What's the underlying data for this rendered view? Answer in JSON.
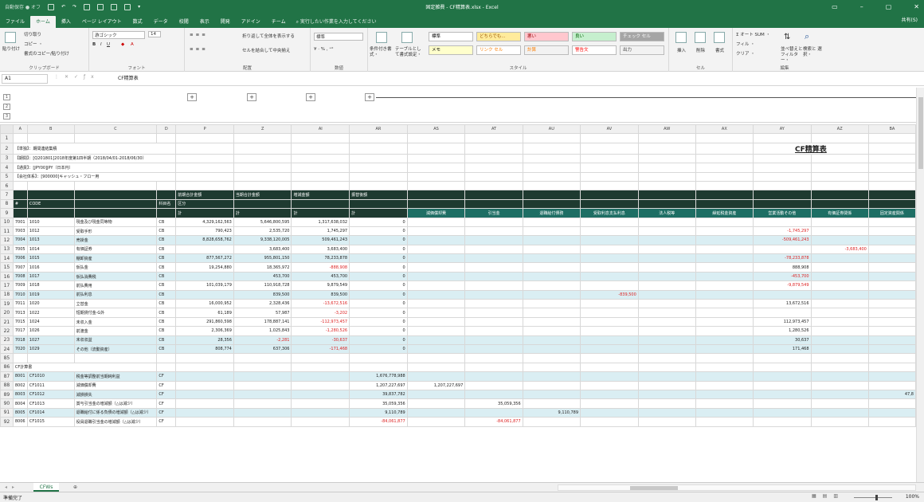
{
  "window": {
    "autosave": "自動保存 ● オフ",
    "title": "固定雑費 - CF精算表.xlsx - Excel",
    "controls": [
      "▭",
      "–",
      "▢",
      "✕"
    ]
  },
  "ribbon_tabs": [
    "ファイル",
    "ホーム",
    "挿入",
    "ページ レイアウト",
    "数式",
    "データ",
    "校閲",
    "表示",
    "開発",
    "アドイン",
    "チーム"
  ],
  "active_tab": "ホーム",
  "tell_me": "実行したい作業を入力してください",
  "share": "共有(S)",
  "ribbon": {
    "clipboard": {
      "paste": "貼り付け",
      "cut": "切り取り",
      "copy": "コピー ・",
      "format_painter": "書式のコピー/貼り付け",
      "label": "クリップボード"
    },
    "font": {
      "name": "游ゴシック",
      "size": "14",
      "label": "フォント"
    },
    "alignment": {
      "wrap": "折り返して全体を表示する",
      "merge": "セルを結合して中央揃え",
      "label": "配置"
    },
    "number": {
      "format": "標準",
      "label": "数値"
    },
    "styles": {
      "cond_format": "条件付き書式・",
      "table_format": "テーブルとして書式設定・",
      "cells": [
        {
          "text": "標準",
          "bg": "#ffffff",
          "color": "#000000"
        },
        {
          "text": "どちらでも...",
          "bg": "#ffeb9c",
          "color": "#9c5700"
        },
        {
          "text": "悪い",
          "bg": "#ffc7ce",
          "color": "#9c0006"
        },
        {
          "text": "良い",
          "bg": "#c6efce",
          "color": "#006100"
        },
        {
          "text": "チェック セル",
          "bg": "#a5a5a5",
          "color": "#ffffff"
        },
        {
          "text": "メモ",
          "bg": "#ffffcc",
          "color": "#000000"
        },
        {
          "text": "リンク セル",
          "bg": "#ffffff",
          "color": "#fa7d00"
        },
        {
          "text": "計算",
          "bg": "#f2f2f2",
          "color": "#fa7d00"
        },
        {
          "text": "警告文",
          "bg": "#ffffff",
          "color": "#ff0000"
        },
        {
          "text": "出力",
          "bg": "#f2f2f2",
          "color": "#3f3f3f"
        }
      ],
      "label": "スタイル"
    },
    "cells": {
      "insert": "挿入",
      "delete": "削除",
      "format": "書式",
      "label": "セル"
    },
    "editing": {
      "autosum": "Σ オート SUM ・",
      "fill": "フィル ・",
      "clear": "クリア ・",
      "sort": "並べ替えと フィルター・",
      "find": "検索と 選択・",
      "label": "編集"
    }
  },
  "name_box": "A1",
  "formula_text": "CF精算表",
  "outline_levels": [
    "1",
    "2",
    "3"
  ],
  "col_headers": [
    "A",
    "B",
    "C",
    "D",
    "P",
    "Z",
    "AI",
    "AR",
    "AS",
    "AT",
    "AU",
    "AV",
    "AW",
    "AX",
    "AY",
    "AZ",
    "BA"
  ],
  "sheet_title": "CF精算表",
  "meta_rows": [
    "【単独】：期間連結集積",
    "【期間】：[Q201801]2018年度第1四半期（2018/04/01-2018/06/30）",
    "【通貨】：[JPY00]JPY（日本円）",
    "【会社体系】：[900000]キャッシュ・フロー用"
  ],
  "table_headers": {
    "num": "#",
    "code": "CODE",
    "name": "科目名",
    "kbn": "区分",
    "prev": "前期合計金額",
    "curr": "当期合計金額",
    "diff": "増減金額",
    "alloc": "振替後額",
    "kei": "計"
  },
  "cf_headers": [
    "減価償却費",
    "引当金",
    "退職給付債務",
    "受取利息支払利息",
    "法人税等",
    "繰延税金資産",
    "営業活動その他",
    "有価証券関係",
    "固定資産関係"
  ],
  "rows": [
    {
      "r": "10",
      "a": "7001",
      "b": "1010",
      "c": "現金及び現金同等物",
      "d": "CB",
      "p": "4,329,162,563",
      "z": "5,646,800,595",
      "ai": "1,317,638,032",
      "ar": "0",
      "cells": [
        "",
        "",
        "",
        "",
        "",
        "",
        "",
        "",
        ""
      ],
      "tl": false
    },
    {
      "r": "11",
      "a": "7003",
      "b": "1012",
      "c": "受取手形",
      "d": "CB",
      "p": "790,423",
      "z": "2,535,720",
      "ai": "1,745,297",
      "ar": "0",
      "cells": [
        "",
        "",
        "",
        "",
        "",
        "",
        "-1,745,297",
        "",
        ""
      ],
      "tl": false
    },
    {
      "r": "12",
      "a": "7004",
      "b": "1013",
      "c": "売掛金",
      "d": "CB",
      "p": "8,828,658,762",
      "z": "9,338,120,005",
      "ai": "509,461,243",
      "ar": "0",
      "cells": [
        "",
        "",
        "",
        "",
        "",
        "",
        "-509,461,243",
        "",
        ""
      ],
      "tl": true
    },
    {
      "r": "13",
      "a": "7005",
      "b": "1014",
      "c": "有価証券",
      "d": "CB",
      "p": "",
      "z": "3,683,400",
      "ai": "3,683,400",
      "ar": "0",
      "cells": [
        "",
        "",
        "",
        "",
        "",
        "",
        "",
        "-3,683,400",
        ""
      ],
      "tl": false
    },
    {
      "r": "14",
      "a": "7006",
      "b": "1015",
      "c": "棚卸資産",
      "d": "CB",
      "p": "877,567,272",
      "z": "955,801,150",
      "ai": "78,233,878",
      "ar": "0",
      "cells": [
        "",
        "",
        "",
        "",
        "",
        "",
        "-78,233,878",
        "",
        ""
      ],
      "tl": true
    },
    {
      "r": "15",
      "a": "7007",
      "b": "1016",
      "c": "仮払金",
      "d": "CB",
      "p": "19,254,880",
      "z": "18,365,972",
      "ai": "-888,908",
      "ar": "0",
      "cells": [
        "",
        "",
        "",
        "",
        "",
        "",
        "888,908",
        "",
        ""
      ],
      "tl": false
    },
    {
      "r": "16",
      "a": "7008",
      "b": "1017",
      "c": "仮払消費税",
      "d": "CB",
      "p": "",
      "z": "453,700",
      "ai": "453,700",
      "ar": "0",
      "cells": [
        "",
        "",
        "",
        "",
        "",
        "",
        "-453,700",
        "",
        ""
      ],
      "tl": true
    },
    {
      "r": "17",
      "a": "7009",
      "b": "1018",
      "c": "前払費用",
      "d": "CB",
      "p": "101,039,179",
      "z": "110,918,728",
      "ai": "9,879,549",
      "ar": "0",
      "cells": [
        "",
        "",
        "",
        "",
        "",
        "",
        "-9,879,549",
        "",
        ""
      ],
      "tl": false
    },
    {
      "r": "18",
      "a": "7010",
      "b": "1019",
      "c": "前払利息",
      "d": "CB",
      "p": "",
      "z": "839,500",
      "ai": "839,500",
      "ar": "0",
      "cells": [
        "",
        "",
        "",
        "-839,500",
        "",
        "",
        "",
        "",
        ""
      ],
      "tl": true
    },
    {
      "r": "19",
      "a": "7011",
      "b": "1020",
      "c": "立替金",
      "d": "CB",
      "p": "16,000,952",
      "z": "2,328,436",
      "ai": "-13,672,516",
      "ar": "0",
      "cells": [
        "",
        "",
        "",
        "",
        "",
        "",
        "13,672,516",
        "",
        ""
      ],
      "tl": false
    },
    {
      "r": "20",
      "a": "7013",
      "b": "1022",
      "c": "短期貸付金-G外",
      "d": "CB",
      "p": "61,189",
      "z": "57,987",
      "ai": "-3,202",
      "ar": "0",
      "cells": [
        "",
        "",
        "",
        "",
        "",
        "",
        "",
        "",
        ""
      ],
      "tl": false
    },
    {
      "r": "21",
      "a": "7015",
      "b": "1024",
      "c": "未収入金",
      "d": "CB",
      "p": "291,860,598",
      "z": "178,887,141",
      "ai": "-112,973,457",
      "ar": "0",
      "cells": [
        "",
        "",
        "",
        "",
        "",
        "",
        "112,973,457",
        "",
        ""
      ],
      "tl": false
    },
    {
      "r": "22",
      "a": "7017",
      "b": "1026",
      "c": "前渡金",
      "d": "CB",
      "p": "2,306,369",
      "z": "1,025,843",
      "ai": "-1,280,526",
      "ar": "0",
      "cells": [
        "",
        "",
        "",
        "",
        "",
        "",
        "1,280,526",
        "",
        ""
      ],
      "tl": false
    },
    {
      "r": "23",
      "a": "7018",
      "b": "1027",
      "c": "未収収益",
      "d": "CB",
      "p": "28,356",
      "z": "-2,281",
      "ai": "-30,637",
      "ar": "0",
      "cells": [
        "",
        "",
        "",
        "",
        "",
        "",
        "30,637",
        "",
        ""
      ],
      "tl": true
    },
    {
      "r": "24",
      "a": "7020",
      "b": "1029",
      "c": "その他（流動資産）",
      "d": "CB",
      "p": "808,774",
      "z": "637,306",
      "ai": "-171,468",
      "ar": "0",
      "cells": [
        "",
        "",
        "",
        "",
        "",
        "",
        "171,468",
        "",
        ""
      ],
      "tl": true
    }
  ],
  "cf_section": {
    "r": "86",
    "label": "CF計算書"
  },
  "cf_rows": [
    {
      "r": "87",
      "a": "8001",
      "b": "CF1010",
      "c": "税金等調整前当期純利益",
      "d": "CF",
      "ar": "1,676,778,988",
      "cells": [
        "",
        "",
        "",
        "",
        "",
        "",
        "",
        "",
        ""
      ],
      "tl": true
    },
    {
      "r": "88",
      "a": "8002",
      "b": "CF1011",
      "c": "減価償却費",
      "d": "CF",
      "ar": "1,207,227,697",
      "cells": [
        "1,207,227,697",
        "",
        "",
        "",
        "",
        "",
        "",
        "",
        ""
      ],
      "tl": false
    },
    {
      "r": "89",
      "a": "8003",
      "b": "CF1012",
      "c": "減損損失",
      "d": "CF",
      "ar": "39,837,782",
      "cells": [
        "",
        "",
        "",
        "",
        "",
        "",
        "",
        "",
        "47,8"
      ],
      "tl": true
    },
    {
      "r": "90",
      "a": "8004",
      "b": "CF1013",
      "c": "賞与引当金の増減額（△は減少）",
      "d": "CF",
      "ar": "35,059,356",
      "cells": [
        "",
        "35,059,356",
        "",
        "",
        "",
        "",
        "",
        "",
        ""
      ],
      "tl": false
    },
    {
      "r": "91",
      "a": "8005",
      "b": "CF1014",
      "c": "退職給付に係る負債の増減額（△は減少）",
      "d": "CF",
      "ar": "9,110,789",
      "cells": [
        "",
        "",
        "9,110,789",
        "",
        "",
        "",
        "",
        "",
        ""
      ],
      "tl": true
    },
    {
      "r": "92",
      "a": "8006",
      "b": "CF1015",
      "c": "役員退職引当金の増減額（△は減少）",
      "d": "CF",
      "ar": "-84,061,877",
      "cells": [
        "",
        "-84,061,877",
        "",
        "",
        "",
        "",
        "",
        "",
        ""
      ],
      "tl": false
    }
  ],
  "sheet_tab": "CFWs",
  "status": "準備完了",
  "zoom": "100%"
}
